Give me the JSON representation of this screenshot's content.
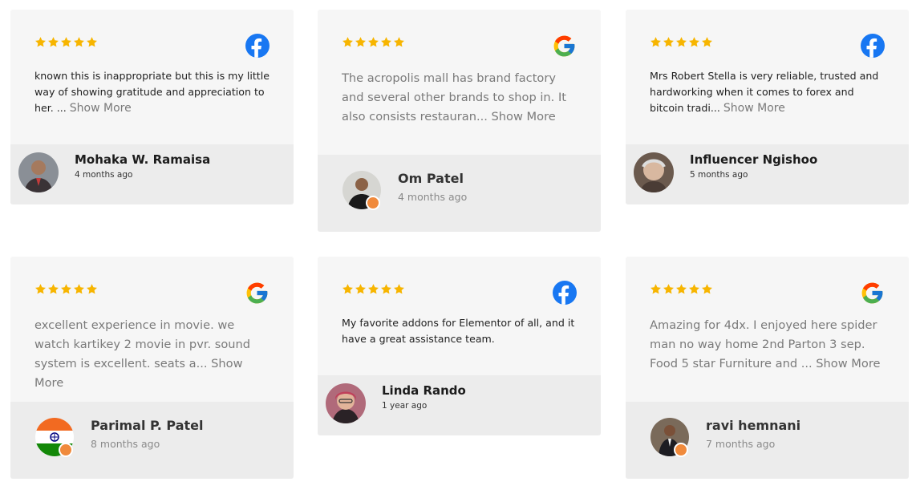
{
  "cards": [
    {
      "platform_icon": "facebook-icon",
      "review_text": "known this is inappropriate but this is my little way of showing gratitude and appreciation to her. ...",
      "show_more": "Show More",
      "reviewer_name": "Mohaka W. Ramaisa",
      "time_ago": "4 months ago",
      "rating": 5
    },
    {
      "platform_icon": "google-icon",
      "review_text": "The acropolis mall has brand factory and several other brands to shop in. It also consists restauran...",
      "show_more": "Show More",
      "reviewer_name": "Om Patel",
      "time_ago": "4 months ago",
      "rating": 5
    },
    {
      "platform_icon": "facebook-icon",
      "review_text": "Mrs Robert Stella is very reliable, trusted and hardworking when it comes to forex and bitcoin tradi...",
      "show_more": "Show More",
      "reviewer_name": "Influencer Ngishoo",
      "time_ago": "5 months ago",
      "rating": 5
    },
    {
      "platform_icon": "google-icon",
      "review_text": "excellent experience in movie. we watch kartikey 2 movie in pvr. sound system is excellent. seats a...",
      "show_more": "Show More",
      "reviewer_name": "Parimal P. Patel",
      "time_ago": "8 months ago",
      "rating": 5
    },
    {
      "platform_icon": "facebook-icon",
      "review_text": "My favorite addons for Elementor of all, and it have a great assistance team.",
      "show_more": "",
      "reviewer_name": "Linda Rando",
      "time_ago": "1 year ago",
      "rating": 5
    },
    {
      "platform_icon": "google-icon",
      "review_text": "Amazing for 4dx. I enjoyed here spider man no way home 2nd Parton 3 sep. Food 5 star Furniture and ...",
      "show_more": "Show More",
      "reviewer_name": "ravi hemnani",
      "time_ago": "7 months ago",
      "rating": 5
    }
  ],
  "colors": {
    "star": "#f7b500",
    "facebook": "#1877f2",
    "badge": "#f08a3c"
  }
}
